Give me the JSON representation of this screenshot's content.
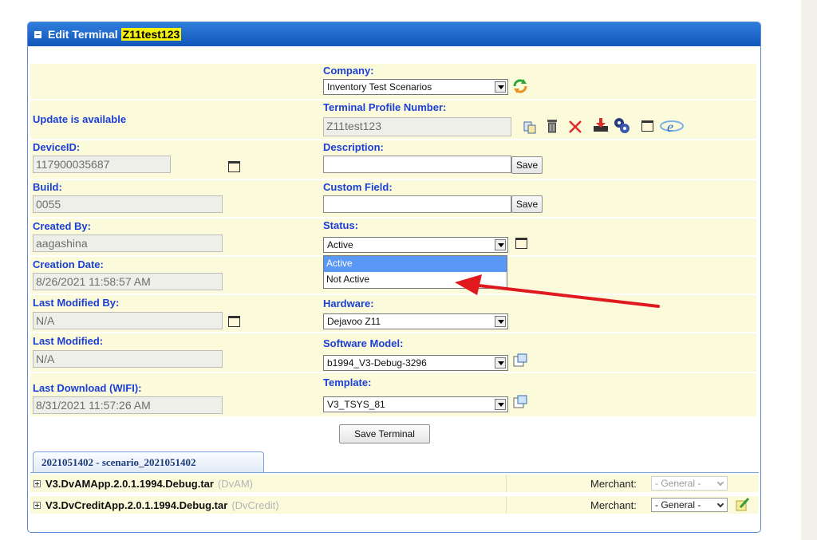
{
  "header": {
    "title": "Edit Terminal",
    "terminal_id": "Z11test123"
  },
  "left": {
    "update_notice": "Update is available",
    "device_id": {
      "label": "DeviceID:",
      "value": "117900035687"
    },
    "build": {
      "label": "Build:",
      "value": "0055"
    },
    "created_by": {
      "label": "Created By:",
      "value": "aagashina"
    },
    "creation_date": {
      "label": "Creation Date:",
      "value": "8/26/2021 11:58:57 AM"
    },
    "last_modified_by": {
      "label": "Last Modified By:",
      "value": "N/A"
    },
    "last_modified": {
      "label": "Last Modified:",
      "value": "N/A"
    },
    "last_download": {
      "label": "Last Download (WIFI):",
      "value": "8/31/2021 11:57:26 AM"
    }
  },
  "right": {
    "company": {
      "label": "Company:",
      "value": "Inventory Test Scenarios"
    },
    "profile": {
      "label": "Terminal Profile Number:",
      "value": "Z11test123"
    },
    "description": {
      "label": "Description:",
      "value": "",
      "save_label": "Save"
    },
    "custom_field": {
      "label": "Custom Field:",
      "value": "",
      "save_label": "Save"
    },
    "status": {
      "label": "Status:",
      "value": "Active",
      "options": [
        "Active",
        "Not Active"
      ]
    },
    "hardware": {
      "label": "Hardware:",
      "value": "Dejavoo Z11"
    },
    "software_model": {
      "label": "Software Model:",
      "value": "b1994_V3-Debug-3296"
    },
    "template": {
      "label": "Template:",
      "value": "V3_TSYS_81"
    }
  },
  "save_terminal_label": "Save Terminal",
  "tab": {
    "label": "2021051402 - scenario_2021051402"
  },
  "apps": [
    {
      "name": "V3.DvAMApp.2.0.1.1994.Debug.tar",
      "short": "(DvAM)",
      "merchant_label": "Merchant:",
      "merchant_value": "- General -",
      "disabled": true
    },
    {
      "name": "V3.DvCreditApp.2.0.1.1994.Debug.tar",
      "short": "(DvCredit)",
      "merchant_label": "Merchant:",
      "merchant_value": "- General -",
      "disabled": false
    }
  ],
  "colors": {
    "header_blue": "#1257b9",
    "label_blue": "#1b3ed6",
    "row_yellow": "#fbfbdc",
    "annotation_arrow": "#e0191e",
    "selected_option": "#5a98f6"
  },
  "icons": [
    "refresh-icon",
    "copy-icon",
    "trash-icon",
    "delete-x-icon",
    "download-icon",
    "gear-icon",
    "calendar-icon",
    "ie-icon",
    "popup-icon",
    "edit-icon"
  ]
}
